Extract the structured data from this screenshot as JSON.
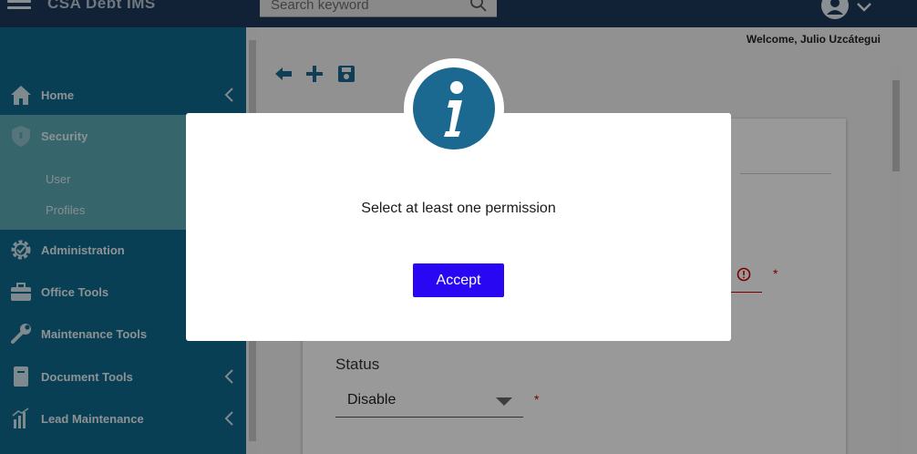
{
  "app": {
    "brand": "CSA Debt IMS"
  },
  "search": {
    "placeholder": "Search keyword"
  },
  "header": {
    "welcome": "Welcome, Julio Uzcátegui"
  },
  "sidebar": {
    "items": [
      {
        "label": "Home",
        "icon": "home-icon"
      },
      {
        "label": "Security",
        "icon": "shield-icon",
        "active": true
      },
      {
        "label": "Administration",
        "icon": "gear-check-icon"
      },
      {
        "label": "Office Tools",
        "icon": "briefcase-icon"
      },
      {
        "label": "Maintenance Tools",
        "icon": "wrench-icon"
      },
      {
        "label": "Document Tools",
        "icon": "book-icon"
      },
      {
        "label": "Lead Maintenance",
        "icon": "bar-chart-icon"
      }
    ],
    "sub_items": [
      {
        "label": "User"
      },
      {
        "label": "Profiles"
      }
    ]
  },
  "form": {
    "status_label": "Status",
    "status_value": "Disable",
    "required_mark": "*"
  },
  "modal": {
    "message": "Select at least one permission",
    "accept_label": "Accept"
  },
  "colors": {
    "topbar": "#1f3a5a",
    "sidebar": "#0f6a8c",
    "sidebar_active": "#5aa8b4",
    "accept_button": "#2a07f2",
    "info_icon": "#1b6890"
  }
}
